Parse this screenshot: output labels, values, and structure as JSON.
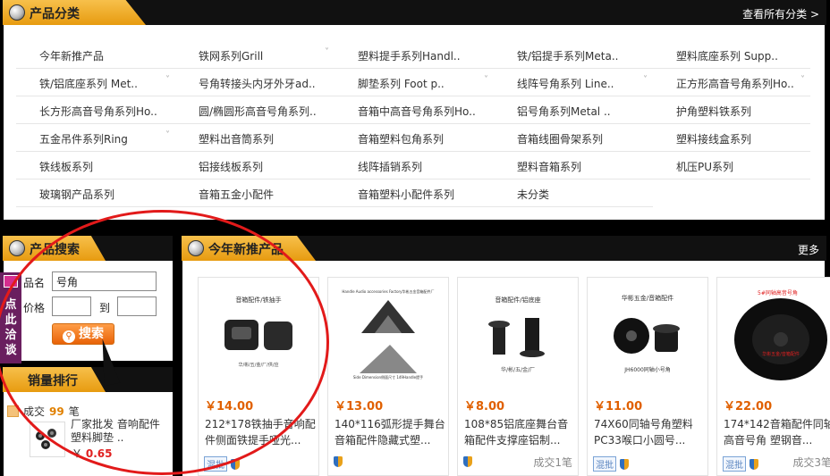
{
  "categories": {
    "title": "产品分类",
    "view_all": "查看所有分类 >",
    "items": [
      {
        "label": "今年新推产品",
        "chev": false
      },
      {
        "label": "铁网系列Grill",
        "chev": true
      },
      {
        "label": "塑料提手系列Handl..",
        "chev": false
      },
      {
        "label": "铁/铝提手系列Meta..",
        "chev": false
      },
      {
        "label": "塑料底座系列 Supp..",
        "chev": false
      },
      {
        "label": "铁/铝底座系列 Met..",
        "chev": true
      },
      {
        "label": "号角转接头内牙外牙ad..",
        "chev": false
      },
      {
        "label": "脚垫系列 Foot p..",
        "chev": true
      },
      {
        "label": "线阵号角系列 Line..",
        "chev": true
      },
      {
        "label": "正方形高音号角系列Ho..",
        "chev": true
      },
      {
        "label": "长方形高音号角系列Ho..",
        "chev": false
      },
      {
        "label": "圆/椭圆形高音号角系列..",
        "chev": false
      },
      {
        "label": "音箱中高音号角系列Ho..",
        "chev": false
      },
      {
        "label": "铝号角系列Metal ..",
        "chev": false
      },
      {
        "label": "护角塑料铁系列",
        "chev": false
      },
      {
        "label": "五金吊件系列Ring",
        "chev": true
      },
      {
        "label": "塑料出音筒系列",
        "chev": false
      },
      {
        "label": "音箱塑料包角系列",
        "chev": false
      },
      {
        "label": "音箱线圈骨架系列",
        "chev": false
      },
      {
        "label": "塑料接线盒系列",
        "chev": false
      },
      {
        "label": "铁线板系列",
        "chev": false
      },
      {
        "label": "铝接线板系列",
        "chev": false
      },
      {
        "label": "线阵插销系列",
        "chev": false
      },
      {
        "label": "塑料音箱系列",
        "chev": false
      },
      {
        "label": "机压PU系列",
        "chev": false
      },
      {
        "label": "玻璃钢产品系列",
        "chev": false
      },
      {
        "label": "音箱五金小配件",
        "chev": false
      },
      {
        "label": "音箱塑料小配件系列",
        "chev": false
      },
      {
        "label": "未分类",
        "chev": false
      }
    ]
  },
  "search": {
    "title": "产品搜索",
    "name_label": "品名",
    "name_value": "号角",
    "price_label": "价格",
    "to_label": "到",
    "button": "搜索"
  },
  "side_tab": {
    "text": "点此洽谈"
  },
  "sales": {
    "title": "销量排行",
    "prefix": "成交",
    "count": "99",
    "suffix": "笔",
    "item_name": "厂家批发 音响配件 塑料脚垫 ..",
    "item_price_symbol": "￥",
    "item_price": "0.65"
  },
  "new_products": {
    "title": "今年新推产品",
    "more": "更多",
    "wholesale_tag": "混批",
    "items": [
      {
        "price": "￥14.00",
        "name": "212*178铁抽手音响配件侧面铁提手哑光...",
        "img_caption": "音箱配件/铁抽手",
        "img_caption2": "华/彬/五/金/厂/供/应",
        "tag": true,
        "deals": ""
      },
      {
        "price": "￥13.00",
        "name": "140*116弧形提手舞台音箱配件隐藏式塑...",
        "img_caption": "Handle Audio accessories Factory华彬五金音箱配件厂",
        "img_caption2": "Side Dimension侧面尺寸 149Handle提手",
        "tag": false,
        "deals": ""
      },
      {
        "price": "￥8.00",
        "name": "108*85铝底座舞台音箱配件支撑座铝制...",
        "img_caption": "音箱配件/铝底座",
        "img_caption2": "华/彬/五/金/厂",
        "tag": false,
        "deals": "成交1笔"
      },
      {
        "price": "￥11.00",
        "name": "74X60同轴号角塑料PC33喉口小圆号...",
        "img_caption": "华彬五金/音箱配件",
        "img_caption2": "JH6000同轴小号角",
        "tag": true,
        "deals": ""
      },
      {
        "price": "￥22.00",
        "name": "174*142音箱配件同轴高音号角 塑钢音...",
        "img_caption": "5#同轴高音号角",
        "img_caption2": "华彬五金/音箱配件",
        "tag": true,
        "deals": "成交3笔"
      }
    ]
  },
  "colors": {
    "accent": "#f0a82a",
    "price": "#e06000",
    "side_tab": "#6a1f5f",
    "annotation": "#e21a1a"
  }
}
